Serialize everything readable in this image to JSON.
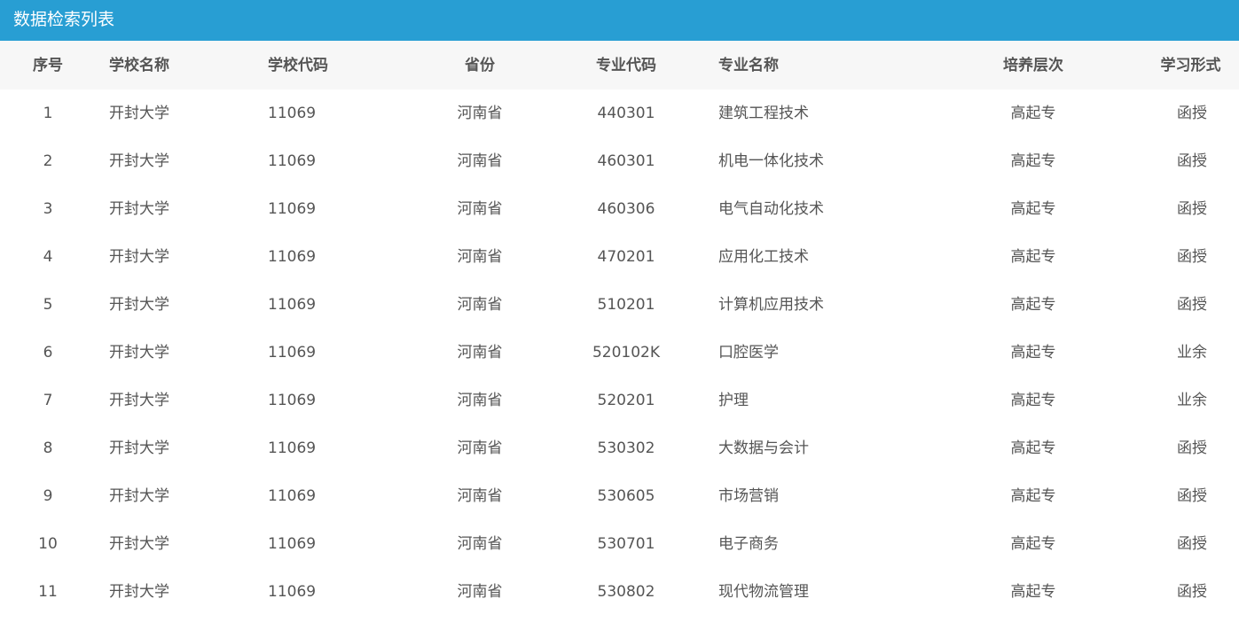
{
  "header": {
    "title": "数据检索列表"
  },
  "table": {
    "columns": [
      "序号",
      "学校名称",
      "学校代码",
      "省份",
      "专业代码",
      "专业名称",
      "培养层次",
      "学习形式"
    ],
    "rows": [
      [
        "1",
        "开封大学",
        "11069",
        "河南省",
        "440301",
        "建筑工程技术",
        "高起专",
        "函授"
      ],
      [
        "2",
        "开封大学",
        "11069",
        "河南省",
        "460301",
        "机电一体化技术",
        "高起专",
        "函授"
      ],
      [
        "3",
        "开封大学",
        "11069",
        "河南省",
        "460306",
        "电气自动化技术",
        "高起专",
        "函授"
      ],
      [
        "4",
        "开封大学",
        "11069",
        "河南省",
        "470201",
        "应用化工技术",
        "高起专",
        "函授"
      ],
      [
        "5",
        "开封大学",
        "11069",
        "河南省",
        "510201",
        "计算机应用技术",
        "高起专",
        "函授"
      ],
      [
        "6",
        "开封大学",
        "11069",
        "河南省",
        "520102K",
        "口腔医学",
        "高起专",
        "业余"
      ],
      [
        "7",
        "开封大学",
        "11069",
        "河南省",
        "520201",
        "护理",
        "高起专",
        "业余"
      ],
      [
        "8",
        "开封大学",
        "11069",
        "河南省",
        "530302",
        "大数据与会计",
        "高起专",
        "函授"
      ],
      [
        "9",
        "开封大学",
        "11069",
        "河南省",
        "530605",
        "市场营销",
        "高起专",
        "函授"
      ],
      [
        "10",
        "开封大学",
        "11069",
        "河南省",
        "530701",
        "电子商务",
        "高起专",
        "函授"
      ],
      [
        "11",
        "开封大学",
        "11069",
        "河南省",
        "530802",
        "现代物流管理",
        "高起专",
        "函授"
      ]
    ]
  },
  "colors": {
    "header_bg": "#289ed3",
    "thead_bg": "#f7f7f7",
    "text": "#555555"
  }
}
